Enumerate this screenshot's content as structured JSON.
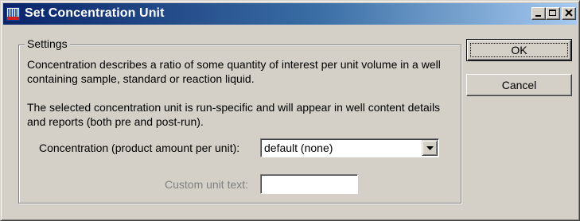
{
  "window": {
    "title": "Set Concentration Unit"
  },
  "titlebar_buttons": {
    "minimize": "_",
    "maximize": "□",
    "close": "×"
  },
  "settings": {
    "group_label": "Settings",
    "description1": "Concentration describes a ratio of some quantity of interest per unit volume in a well containing sample, standard or reaction liquid.",
    "description2": "The selected concentration unit is run-specific and will appear in well content details and reports (both pre and post-run).",
    "concentration_label": "Concentration (product amount per unit):",
    "concentration_value": "default (none)",
    "custom_unit_label": "Custom unit text:",
    "custom_unit_value": ""
  },
  "buttons": {
    "ok": "OK",
    "cancel": "Cancel"
  },
  "icons": {
    "app": "app-grid-icon",
    "dropdown": "chevron-down-icon",
    "minimize": "minimize-icon",
    "maximize": "maximize-icon",
    "close": "close-icon"
  },
  "colors": {
    "titlebar_start": "#0a246a",
    "titlebar_end": "#a6caf0",
    "face": "#d4d0c8",
    "disabled_text": "#808080"
  }
}
